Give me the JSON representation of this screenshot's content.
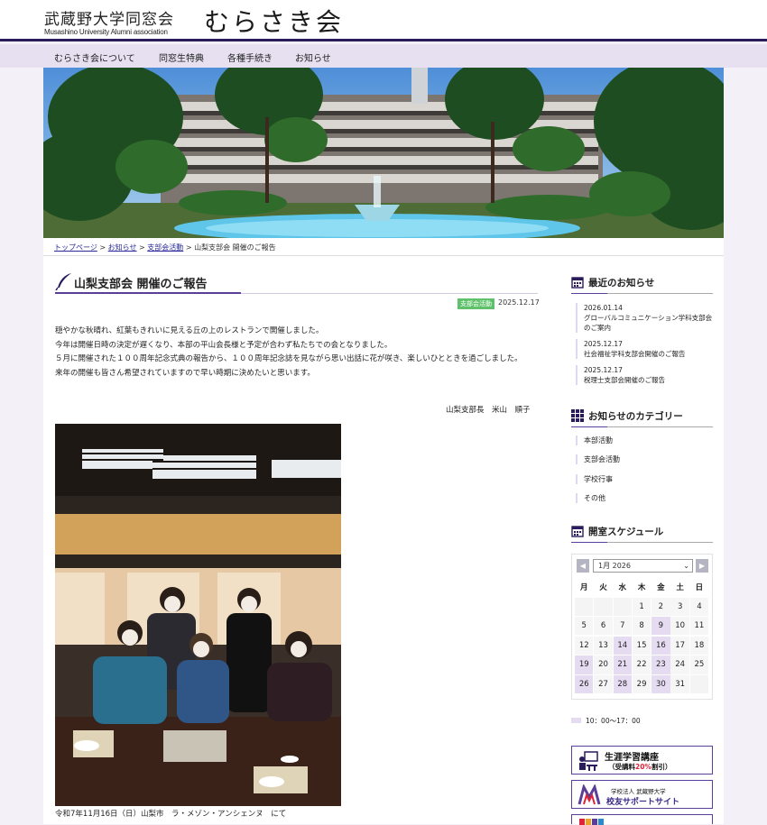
{
  "header": {
    "logo_kanji": "武蔵野大学同窓会",
    "logo_en": "Musashino University Alumni association",
    "logo_big": "むらさき会"
  },
  "nav": {
    "items": [
      "むらさき会について",
      "同窓生特典",
      "各種手続き",
      "お知らせ"
    ]
  },
  "breadcrumb": {
    "top": "トップページ",
    "news": "お知らせ",
    "category": "支部会活動",
    "current": "山梨支部会 開催のご報告",
    "sep": ">"
  },
  "article": {
    "title": "山梨支部会 開催のご報告",
    "tag": "支部会活動",
    "date": "2025.12.17",
    "paragraphs": [
      "穏やかな秋晴れ、紅葉もきれいに見える丘の上のレストランで開催しました。",
      "今年は開催日時の決定が遅くなり、本部の平山会長様と予定が合わず私たちでの会となりました。",
      "５月に開催された１００周年記念式典の報告から、１００周年記念誌を見ながら思い出話に花が咲き、楽しいひとときを過ごしました。",
      "来年の開催も皆さん希望されていますので早い時期に決めたいと思います。"
    ],
    "signature": "山梨支部長　米山　順子",
    "caption": "令和7年11月16日（日）山梨市　ラ・メゾン・アンシェンヌ　にて"
  },
  "sidebar": {
    "recent_title": "最近のお知らせ",
    "recent": [
      {
        "date": "2026.01.14",
        "title": "グローバルコミュニケーション学科支部会のご案内"
      },
      {
        "date": "2025.12.17",
        "title": "社会福祉学科支部会開催のご報告"
      },
      {
        "date": "2025.12.17",
        "title": "税理士支部会開催のご報告"
      }
    ],
    "category_title": "お知らせのカテゴリー",
    "categories": [
      "本部活動",
      "支部会活動",
      "学校行事",
      "その他"
    ],
    "schedule_title": "開室スケジュール",
    "calendar": {
      "month_label": "1月 2026",
      "prev": "◀",
      "next": "▶",
      "weekdays": [
        "月",
        "火",
        "水",
        "木",
        "金",
        "土",
        "日"
      ],
      "open_days": [
        9,
        14,
        16,
        19,
        21,
        23,
        26,
        28,
        30
      ],
      "weeks": [
        [
          "",
          "",
          "",
          "1",
          "2",
          "3",
          "4"
        ],
        [
          "5",
          "6",
          "7",
          "8",
          "9",
          "10",
          "11"
        ],
        [
          "12",
          "13",
          "14",
          "15",
          "16",
          "17",
          "18"
        ],
        [
          "19",
          "20",
          "21",
          "22",
          "23",
          "24",
          "25"
        ],
        [
          "26",
          "27",
          "28",
          "29",
          "30",
          "31",
          ""
        ]
      ],
      "legend": "10：00～17：00"
    },
    "banner1": {
      "line1": "生涯学習講座",
      "line2_pre": "（受講料",
      "line2_hl": "20%",
      "line2_post": "割引）"
    },
    "banner2": {
      "line1": "学校法人 武蔵野大学",
      "line2": "校友サポートサイト"
    }
  },
  "colors": {
    "accent": "#5b3e98",
    "nav_bg": "#e6e0f1",
    "tag": "#5fc26a",
    "open_day": "#e6dcf1"
  }
}
